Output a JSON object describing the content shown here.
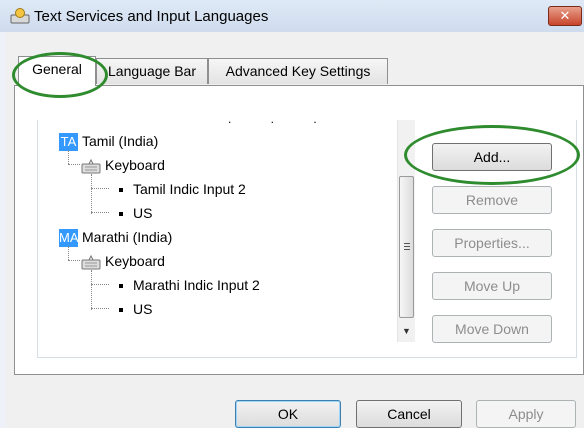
{
  "window": {
    "title": "Text Services and Input Languages",
    "close_label": "✕"
  },
  "tabs": [
    {
      "label": "General"
    },
    {
      "label": "Language Bar"
    },
    {
      "label": "Advanced Key Settings"
    }
  ],
  "languages": [
    {
      "badge": "TA",
      "name": "Tamil (India)",
      "category": "Keyboard",
      "items": [
        "Tamil Indic Input 2",
        "US"
      ]
    },
    {
      "badge": "MA",
      "name": "Marathi (India)",
      "category": "Keyboard",
      "items": [
        "Marathi Indic Input 2",
        "US"
      ]
    }
  ],
  "side_buttons": {
    "add": "Add...",
    "remove": "Remove",
    "properties": "Properties...",
    "move_up": "Move Up",
    "move_down": "Move Down"
  },
  "footer_buttons": {
    "ok": "OK",
    "cancel": "Cancel",
    "apply": "Apply"
  },
  "colors": {
    "badge": "#3399ff",
    "highlight_circle": "#2e8b2e"
  }
}
